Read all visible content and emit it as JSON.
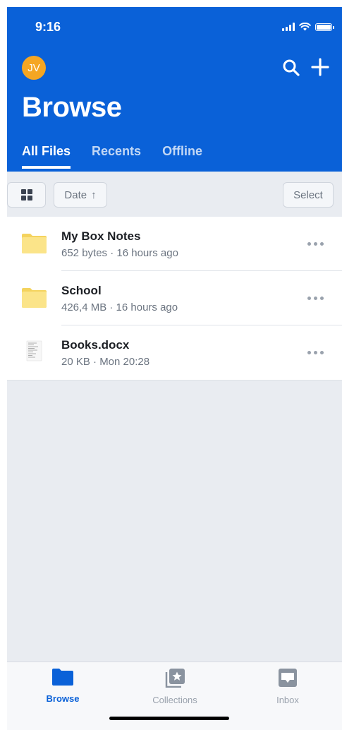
{
  "status_bar": {
    "time": "9:16"
  },
  "header": {
    "avatar_initials": "JV",
    "title": "Browse",
    "tabs": [
      {
        "label": "All Files",
        "active": true
      },
      {
        "label": "Recents",
        "active": false
      },
      {
        "label": "Offline",
        "active": false
      }
    ]
  },
  "toolbar": {
    "sort_label": "Date",
    "sort_arrow": "↑",
    "select_label": "Select"
  },
  "files": [
    {
      "name": "My Box Notes",
      "meta": "652 bytes · 16 hours ago",
      "icon": "folder-icon"
    },
    {
      "name": "School",
      "meta": "426,4 MB · 16 hours ago",
      "icon": "folder-icon"
    },
    {
      "name": "Books.docx",
      "meta": "20 KB · Mon 20:28",
      "icon": "document-icon"
    }
  ],
  "bottom_nav": [
    {
      "label": "Browse",
      "icon": "folder-icon",
      "active": true
    },
    {
      "label": "Collections",
      "icon": "collections-star-icon",
      "active": false
    },
    {
      "label": "Inbox",
      "icon": "inbox-icon",
      "active": false
    }
  ],
  "colors": {
    "brand": "#0a61d8",
    "avatar": "#f5a623",
    "folder": "#fbe489"
  }
}
